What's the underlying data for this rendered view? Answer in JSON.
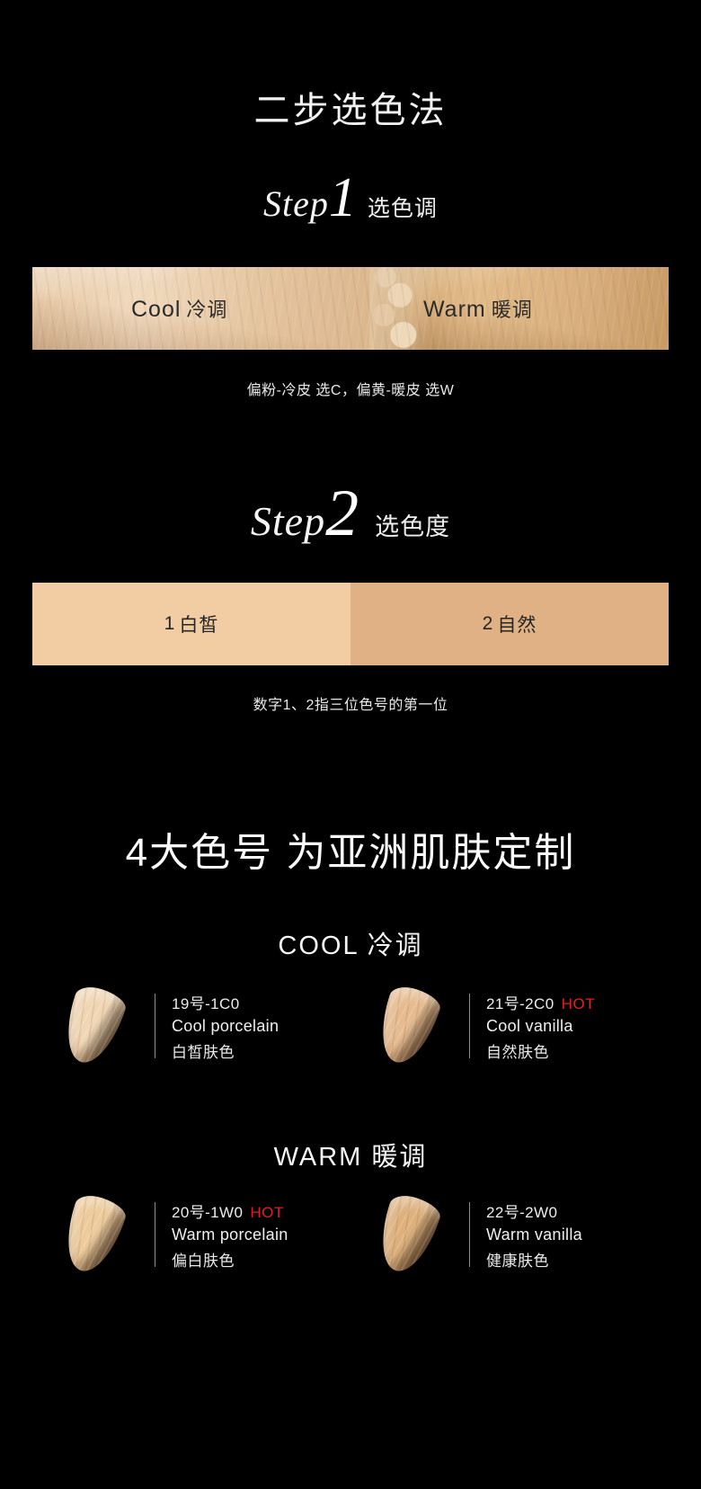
{
  "page": {
    "title": "二步选色法",
    "background_color": "#000000"
  },
  "step1": {
    "word": "Step",
    "number": "1",
    "label_cn": "选色调",
    "swatch": {
      "cool_en": "Cool",
      "cool_cn": "冷调",
      "warm_en": "Warm",
      "warm_cn": "暖调",
      "cool_color": "#eacfac",
      "warm_color": "#d6aa76"
    },
    "caption": "偏粉-冷皮 选C，偏黄-暖皮 选W"
  },
  "step2": {
    "word": "Step",
    "number": "2",
    "label_cn": "选色度",
    "blocks": [
      {
        "num": "1",
        "label": "白皙",
        "color": "#f2cda4"
      },
      {
        "num": "2",
        "label": "自然",
        "color": "#e0b184"
      }
    ],
    "caption": "数字1、2指三位色号的第一位"
  },
  "shades_section": {
    "title": "4大色号 为亚洲肌肤定制",
    "groups": [
      {
        "title": "COOL 冷调",
        "items": [
          {
            "code": "19号-1C0",
            "hot": "",
            "name_en": "Cool porcelain",
            "name_cn": "白皙肤色",
            "color": "#f0d6b4"
          },
          {
            "code": "21号-2C0",
            "hot": "HOT",
            "name_en": "Cool vanilla",
            "name_cn": "自然肤色",
            "color": "#e6bb8f"
          }
        ]
      },
      {
        "title": "WARM 暖调",
        "items": [
          {
            "code": "20号-1W0",
            "hot": "HOT",
            "name_en": "Warm porcelain",
            "name_cn": "偏白肤色",
            "color": "#edcb9c"
          },
          {
            "code": "22号-2W0",
            "hot": "",
            "name_en": "Warm vanilla",
            "name_cn": "健康肤色",
            "color": "#ddb07c"
          }
        ]
      }
    ]
  },
  "colors": {
    "hot_badge": "#e02020",
    "text_primary": "#ffffff",
    "divider": "#8c8c8c"
  }
}
